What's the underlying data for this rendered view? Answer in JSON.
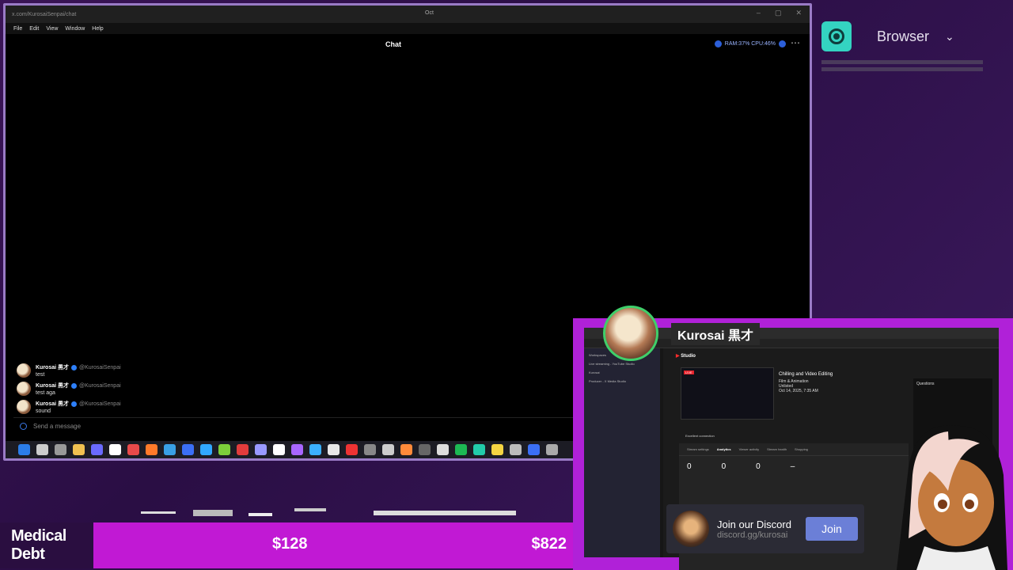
{
  "window": {
    "url": "x.com/KurosaiSenpai/chat",
    "title": "Oct",
    "controls": [
      "–",
      "▢",
      "✕"
    ],
    "menu": [
      "File",
      "Edit",
      "View",
      "Window",
      "Help"
    ]
  },
  "chat": {
    "title": "Chat",
    "system": "RAM:37% CPU:46%",
    "messages": [
      {
        "name": "Kurosai 黒才",
        "handle": "@KurosaiSenpai",
        "text": "test"
      },
      {
        "name": "Kurosai 黒才",
        "handle": "@KurosaiSenpai",
        "text": "test aga"
      },
      {
        "name": "Kurosai 黒才",
        "handle": "@KurosaiSenpai",
        "text": "sound"
      }
    ],
    "composer_placeholder": "Send a message"
  },
  "taskbar": {
    "icon_colors": [
      "#2b7de9",
      "#cccccc",
      "#999999",
      "#f0c050",
      "#6a6aff",
      "#ffffff",
      "#e84a4a",
      "#ff7a2a",
      "#39a0e6",
      "#3b6ff5",
      "#31a8ff",
      "#7ccf3a",
      "#e23c3c",
      "#9999ff",
      "#ffffff",
      "#a866ff",
      "#3bb0ff",
      "#e8e8e8",
      "#e33",
      "#888",
      "#ccc",
      "#ff8a3a",
      "#666",
      "#ddd",
      "#1db954",
      "#22ccaa",
      "#f5d442",
      "#bbb",
      "#3b6ff5",
      "#aaa"
    ]
  },
  "browser_dock": {
    "label": "Browser",
    "icon": "record-icon",
    "accent": "#34d3c1"
  },
  "studio": {
    "logo_label": "Studio",
    "sidebar": [
      "Workspaces",
      "Live streaming - YouTube Studio",
      "Kurosai",
      "Producer - X Media Studio"
    ],
    "live_badge": "LIVE",
    "stream_title": "Chilling and Video Editing",
    "category": "Film & Animation",
    "privacy": "Unlisted",
    "date": "Oct 14, 2025, 7:35 AM",
    "connection": "Excellent connection",
    "tabs": [
      "Stream settings",
      "Analytics",
      "Viewer activity",
      "Stream health",
      "Shopping"
    ],
    "metrics": [
      "0",
      "0",
      "0",
      "–"
    ],
    "questions_label": "Questions"
  },
  "streamer": {
    "name": "Kurosai 黒才",
    "ring_color": "#3fcf6a"
  },
  "discord": {
    "title": "Join our Discord",
    "link": "discord.gg/kurosai",
    "button": "Join"
  },
  "goal": {
    "label": "Medical Debt",
    "current": "$128",
    "target": "$822",
    "bar_color": "#c119d4"
  }
}
